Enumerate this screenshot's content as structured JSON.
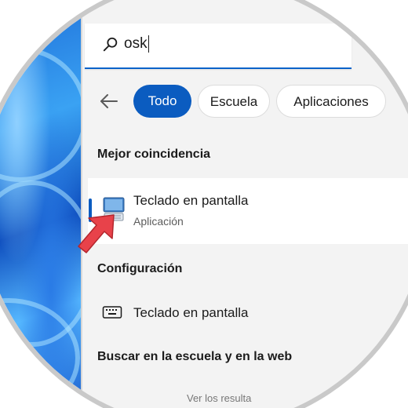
{
  "search": {
    "query": "osk",
    "icon": "search-icon"
  },
  "filters": [
    {
      "label": "Todo",
      "active": true
    },
    {
      "label": "Escuela",
      "active": false
    },
    {
      "label": "Aplicaciones",
      "active": false
    }
  ],
  "best_match": {
    "section_title": "Mejor coincidencia",
    "title": "Teclado en pantalla",
    "subtitle": "Aplicación",
    "icon": "on-screen-keyboard-app-icon"
  },
  "settings": {
    "section_title": "Configuración",
    "item_label": "Teclado en pantalla",
    "item_icon": "keyboard-icon"
  },
  "web": {
    "section_title": "Buscar en la escuela y en la web",
    "partial_item": "Ver los resulta"
  },
  "colors": {
    "accent": "#0b5cc0",
    "panel_bg": "#f3f3f3",
    "pointer_arrow": "#e8424a"
  }
}
